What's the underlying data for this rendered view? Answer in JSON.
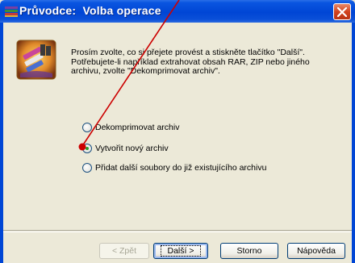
{
  "window": {
    "title": "Průvodce:  Volba operace",
    "close_icon": "close-icon"
  },
  "description": {
    "lines": [
      "Prosím zvolte, co si přejete provést a stiskněte tlačítko \"Další\".",
      "Potřebujete-li například extrahovat obsah RAR, ZIP nebo jiného",
      "archivu, zvolte \"Dekomprimovat archiv\"."
    ]
  },
  "options": [
    {
      "label": "Dekomprimovat archiv",
      "checked": false
    },
    {
      "label": "Vytvořit nový archiv",
      "checked": true
    },
    {
      "label": "Přidat další soubory do již existujícího archivu",
      "checked": false
    }
  ],
  "buttons": {
    "back": "< Zpět",
    "next": "Další >",
    "cancel": "Storno",
    "help": "Nápověda"
  },
  "colors": {
    "titlebar": "#0046d5",
    "face": "#ece9d8",
    "annotation": "#cc0000"
  }
}
